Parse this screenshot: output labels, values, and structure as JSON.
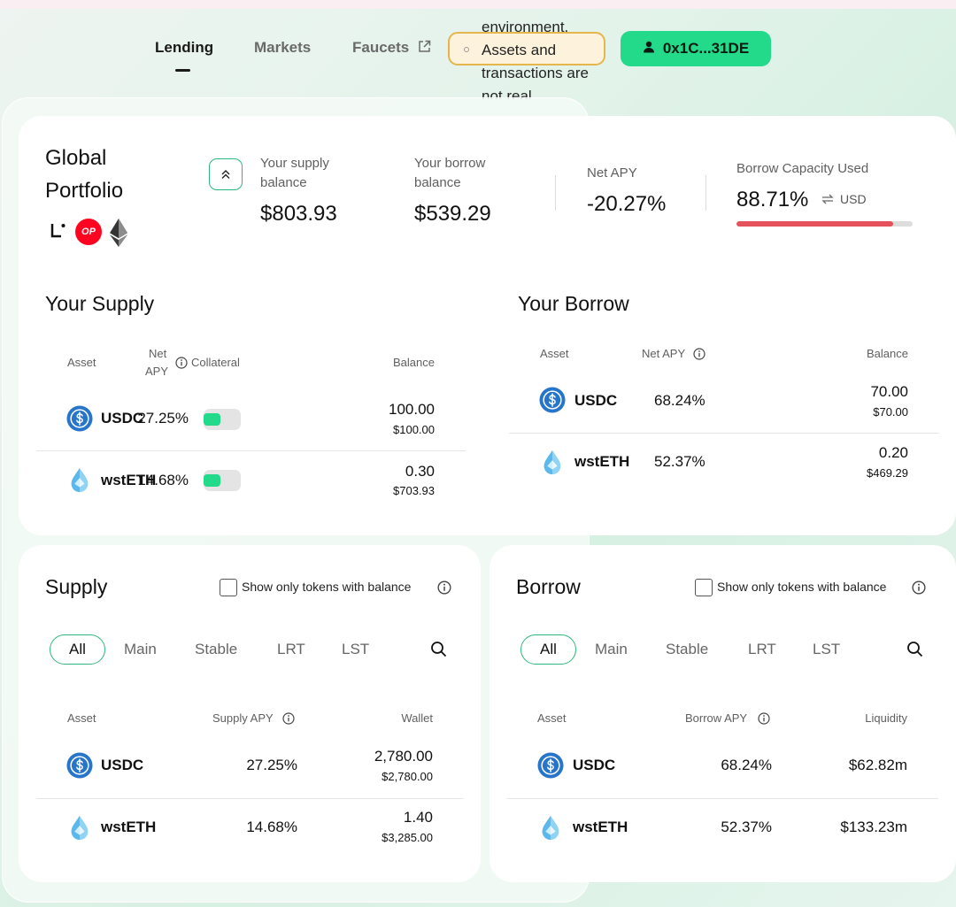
{
  "nav": {
    "lending": "Lending",
    "markets": "Markets",
    "faucets": "Faucets",
    "env_lines": [
      "environment.",
      "Assets and",
      "transactions are",
      "not real."
    ],
    "wallet": "0x1C...31DE"
  },
  "portfolio": {
    "title_line1": "Global",
    "title_line2": "Portfolio",
    "supply_label_1": "Your supply",
    "supply_label_2": "balance",
    "supply_value": "$803.93",
    "borrow_label_1": "Your borrow",
    "borrow_label_2": "balance",
    "borrow_value": "$539.29",
    "net_apy_label": "Net APY",
    "net_apy_value": "-20.27%",
    "capacity_label": "Borrow Capacity Used",
    "capacity_value": "88.71%",
    "capacity_unit": "USD",
    "capacity_fraction": 0.8871
  },
  "your_supply": {
    "title": "Your Supply",
    "headers": {
      "asset": "Asset",
      "net": "Net",
      "apy": "APY",
      "collateral": "Collateral",
      "balance": "Balance"
    },
    "rows": [
      {
        "asset": "USDC",
        "apy": "27.25%",
        "balance": "100.00",
        "usd": "$100.00"
      },
      {
        "asset": "wstETH",
        "apy": "14.68%",
        "balance": "0.30",
        "usd": "$703.93"
      }
    ]
  },
  "your_borrow": {
    "title": "Your Borrow",
    "headers": {
      "asset": "Asset",
      "net_apy": "Net APY",
      "balance": "Balance"
    },
    "rows": [
      {
        "asset": "USDC",
        "apy": "68.24%",
        "balance": "70.00",
        "usd": "$70.00"
      },
      {
        "asset": "wstETH",
        "apy": "52.37%",
        "balance": "0.20",
        "usd": "$469.29"
      }
    ]
  },
  "supply": {
    "title": "Supply",
    "filter_label": "Show only tokens with balance",
    "tabs": [
      "All",
      "Main",
      "Stable",
      "LRT",
      "LST"
    ],
    "headers": {
      "asset": "Asset",
      "apy": "Supply APY",
      "wallet": "Wallet"
    },
    "rows": [
      {
        "asset": "USDC",
        "apy": "27.25%",
        "wallet": "2,780.00",
        "usd": "$2,780.00"
      },
      {
        "asset": "wstETH",
        "apy": "14.68%",
        "wallet": "1.40",
        "usd": "$3,285.00"
      }
    ]
  },
  "borrow": {
    "title": "Borrow",
    "filter_label": "Show only tokens with balance",
    "tabs": [
      "All",
      "Main",
      "Stable",
      "LRT",
      "LST"
    ],
    "headers": {
      "asset": "Asset",
      "apy": "Borrow APY",
      "liquidity": "Liquidity"
    },
    "rows": [
      {
        "asset": "USDC",
        "apy": "68.24%",
        "liquidity": "$62.82m"
      },
      {
        "asset": "wstETH",
        "apy": "52.37%",
        "liquidity": "$133.23m"
      }
    ]
  },
  "icons": {
    "usdc": "usdc-coin-icon",
    "wsteth": "wsteth-drop-icon",
    "linea": "linea-logo-icon",
    "op": "optimism-logo-icon",
    "eth": "ethereum-logo-icon"
  },
  "op_badge": "OP",
  "colors": {
    "accent": "#23d98a",
    "warning_border": "#e4b64c",
    "danger": "#e5525b",
    "usdc_blue": "#2775ca"
  }
}
